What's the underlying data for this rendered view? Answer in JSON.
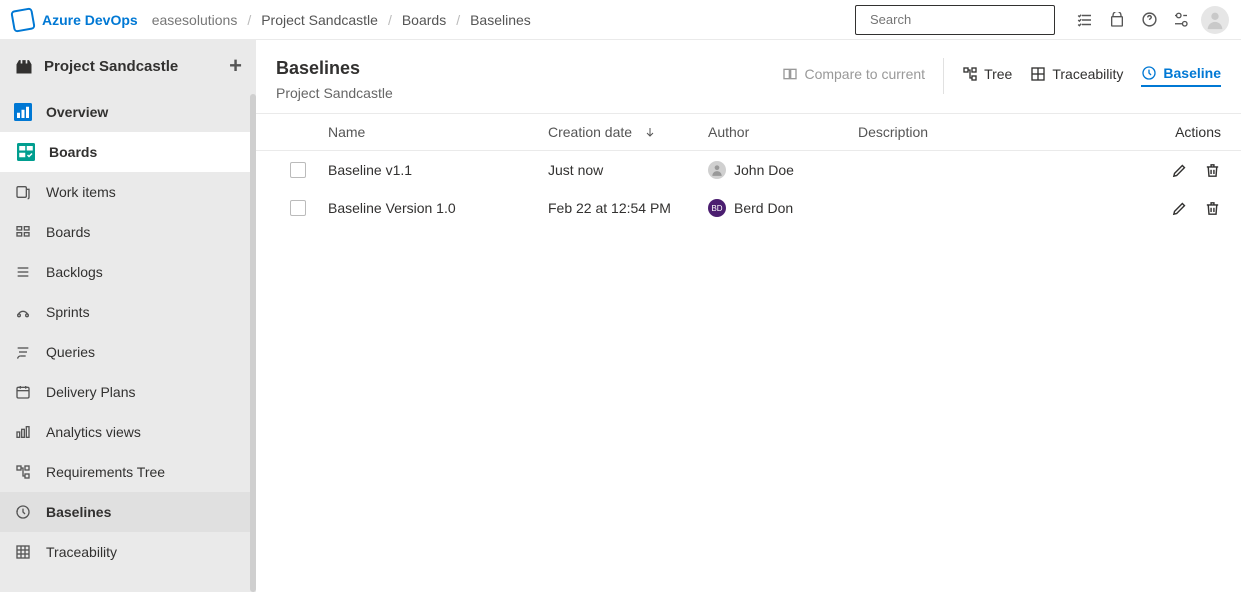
{
  "topbar": {
    "brand": "Azure DevOps",
    "org": "easesolutions",
    "breadcrumbs": [
      "Project Sandcastle",
      "Boards",
      "Baselines"
    ],
    "search_placeholder": "Search"
  },
  "sidebar": {
    "project_name": "Project Sandcastle",
    "sections": {
      "overview": "Overview",
      "boards": "Boards"
    },
    "boards_children": [
      "Work items",
      "Boards",
      "Backlogs",
      "Sprints",
      "Queries",
      "Delivery Plans",
      "Analytics views",
      "Requirements Tree",
      "Baselines",
      "Traceability"
    ]
  },
  "page": {
    "title": "Baselines",
    "subtitle": "Project Sandcastle",
    "actions": {
      "compare": "Compare to current",
      "tree": "Tree",
      "traceability": "Traceability",
      "baseline": "Baseline"
    }
  },
  "table": {
    "headers": {
      "name": "Name",
      "creation": "Creation date",
      "author": "Author",
      "description": "Description",
      "actions": "Actions"
    },
    "rows": [
      {
        "name": "Baseline v1.1",
        "created": "Just now",
        "author": "John Doe",
        "avatar_color": "gray",
        "description": ""
      },
      {
        "name": "Baseline Version 1.0",
        "created": "Feb 22 at 12:54 PM",
        "author": "Berd Don",
        "avatar_color": "purple",
        "description": ""
      }
    ]
  }
}
